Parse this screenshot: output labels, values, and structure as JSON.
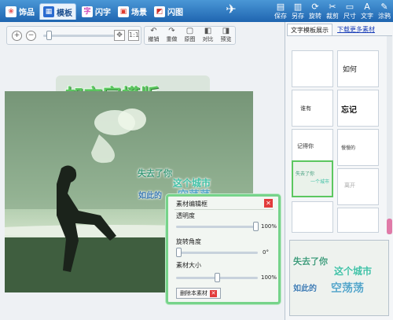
{
  "tabs": [
    {
      "label": "饰品",
      "icon": "ornament-icon",
      "color": "#e55050"
    },
    {
      "label": "模板",
      "icon": "template-icon",
      "color": "#2a6bd0"
    },
    {
      "label": "闪字",
      "icon": "flash-text-icon",
      "color": "#d04ab8"
    },
    {
      "label": "场景",
      "icon": "scene-icon",
      "color": "#e03a2e"
    },
    {
      "label": "闪图",
      "icon": "flash-image-icon",
      "color": "#c9302c"
    }
  ],
  "tools": [
    "保存",
    "另存",
    "旋转",
    "裁剪",
    "尺寸",
    "文字",
    "涂鸦"
  ],
  "edit_buttons": [
    "撤销",
    "重做",
    "原图",
    "对比",
    "预览"
  ],
  "canvas": {
    "title_text": "加文字模版",
    "line1": "失去了你",
    "line2": "这个城市",
    "line3": "如此的",
    "line4": "空荡荡"
  },
  "panel": {
    "title": "素材编辑框",
    "opacity_label": "透明度",
    "opacity_value": "100%",
    "opacity_level": 1.0,
    "rotate_label": "旋转角度",
    "rotate_value": "0°",
    "rotate_level": 0.0,
    "size_label": "素材大小",
    "size_value": "100%",
    "size_level": 0.5,
    "delete_label": "删除本素材"
  },
  "sidebar": {
    "tab_active": "文字模板展示",
    "tab_link": "下载更多素材",
    "thumb_texts": [
      "如何",
      "谁有",
      "忘记",
      "记得你",
      "慢慢的",
      "离开",
      "失去了你",
      "一个城市"
    ]
  },
  "preview": {
    "line1": "失去了你",
    "line2": "这个城市",
    "line3": "如此的",
    "line4": "空荡荡"
  },
  "colors": {
    "accent": "#1f65b0",
    "green": "#5cc760",
    "panel_border": "#76d38a"
  }
}
